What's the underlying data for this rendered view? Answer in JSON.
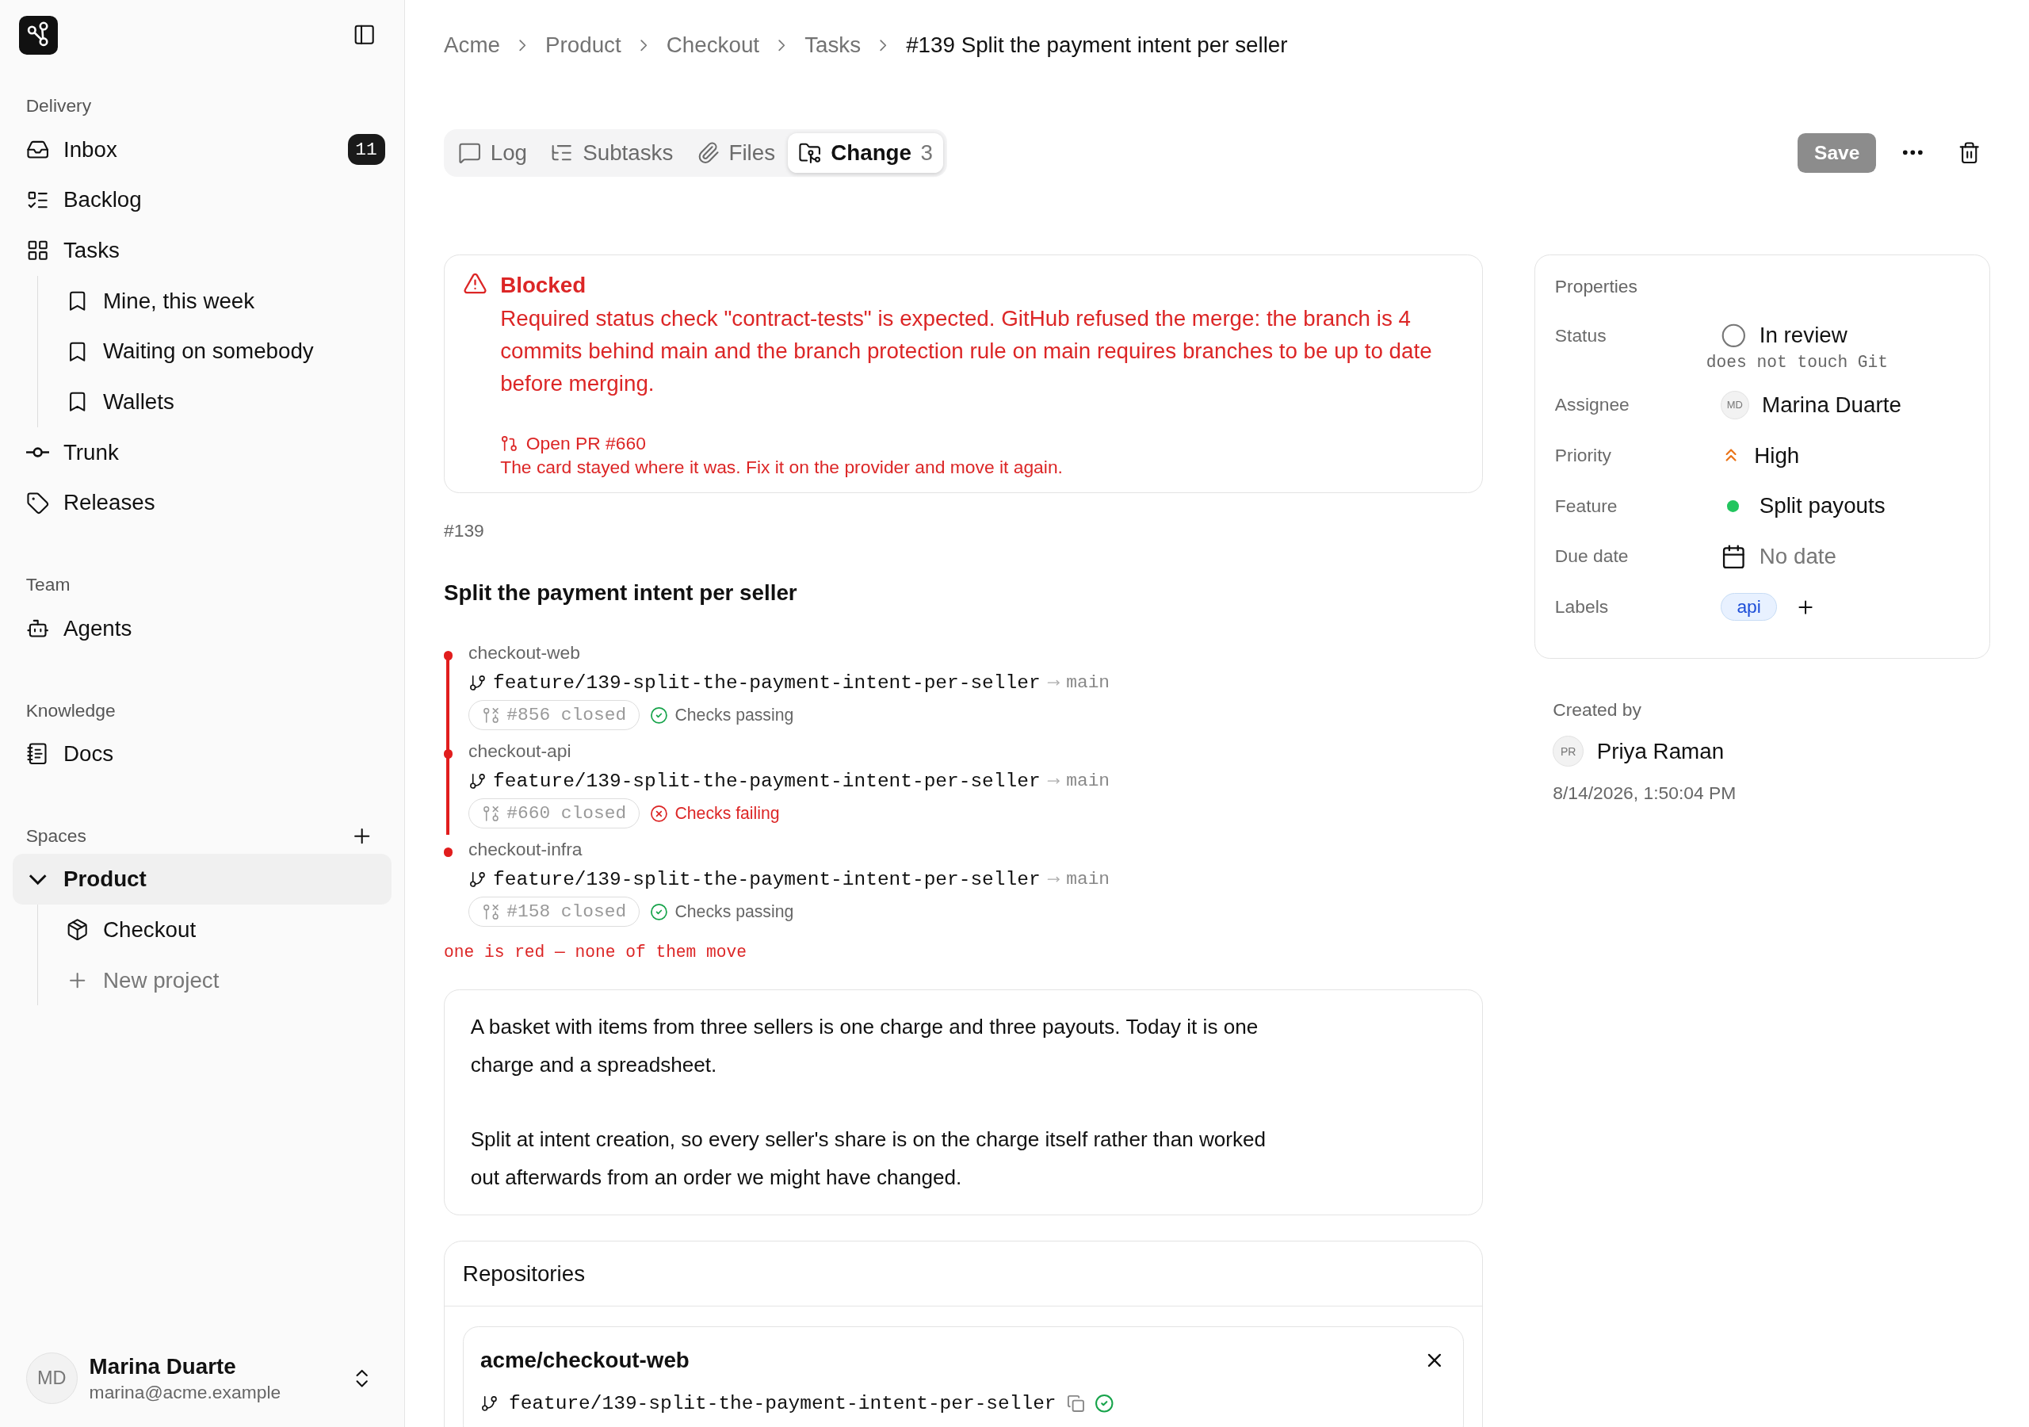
{
  "sidebar": {
    "sections": [
      {
        "label": "Delivery",
        "items": [
          {
            "label": "Inbox",
            "badge": "11",
            "selected": false
          },
          {
            "label": "Backlog",
            "selected": false
          },
          {
            "label": "Tasks",
            "selected": false,
            "children": [
              {
                "label": "Mine, this week",
                "selected": false
              },
              {
                "label": "Waiting on somebody",
                "selected": false
              },
              {
                "label": "Wallets",
                "selected": false
              }
            ]
          },
          {
            "label": "Trunk",
            "selected": false
          },
          {
            "label": "Releases",
            "selected": false
          }
        ]
      },
      {
        "label": "Team",
        "items": [
          {
            "label": "Agents",
            "selected": false
          }
        ]
      },
      {
        "label": "Knowledge",
        "items": [
          {
            "label": "Docs",
            "selected": false
          }
        ]
      },
      {
        "label": "Spaces",
        "can_add": true,
        "items": [
          {
            "label": "Product",
            "selected": true,
            "expanded": true,
            "children": [
              {
                "label": "Checkout",
                "kind": "project",
                "selected": false
              },
              {
                "label": "New project",
                "kind": "add",
                "selected": false
              }
            ]
          }
        ]
      }
    ],
    "user": {
      "initials": "MD",
      "name": "Marina Duarte",
      "email": "marina@acme.example"
    }
  },
  "breadcrumb": [
    "Acme",
    "Product",
    "Checkout",
    "Tasks",
    "#139 Split the payment intent per seller"
  ],
  "tabs": [
    {
      "label": "Log",
      "selected": false
    },
    {
      "label": "Subtasks",
      "selected": false
    },
    {
      "label": "Files",
      "selected": false
    },
    {
      "label": "Change",
      "count": "3",
      "selected": true
    }
  ],
  "save_button": {
    "label": "Save",
    "disabled": true
  },
  "alert": {
    "title": "Blocked",
    "message": "Required status check \"contract-tests\" is expected. GitHub refused the merge: the branch is 4 commits behind main and the branch protection rule on main requires branches to be up to date before merging.",
    "link": "Open PR #660",
    "note": "The card stayed where it was. Fix it on the provider and move it again."
  },
  "task": {
    "number": "#139",
    "title": "Split the payment intent per seller"
  },
  "changes": [
    {
      "repo": "checkout-web",
      "branch": "feature/139-split-the-payment-intent-per-seller",
      "target": "main",
      "pr": "#856 closed",
      "checks": "Checks passing",
      "kind": "passing"
    },
    {
      "repo": "checkout-api",
      "branch": "feature/139-split-the-payment-intent-per-seller",
      "target": "main",
      "pr": "#660 closed",
      "checks": "Checks failing",
      "kind": "failing"
    },
    {
      "repo": "checkout-infra",
      "branch": "feature/139-split-the-payment-intent-per-seller",
      "target": "main",
      "pr": "#158 closed",
      "checks": "Checks passing",
      "kind": "passing"
    }
  ],
  "changes_note": "one is red — none of them move",
  "description": [
    "A basket with items from three sellers is one charge and three payouts. Today it is one charge and a spreadsheet.",
    "Split at intent creation, so every seller's share is on the charge itself rather than worked out afterwards from an order we might have changed."
  ],
  "repositories": {
    "title": "Repositories",
    "items": [
      {
        "name": "acme/checkout-web",
        "branch": "feature/139-split-the-payment-intent-per-seller"
      }
    ]
  },
  "properties": {
    "title": "Properties",
    "rows": [
      {
        "kind": "status",
        "label": "Status",
        "value": "In review",
        "hint": "does not touch Git"
      },
      {
        "kind": "person",
        "label": "Assignee",
        "initials": "MD",
        "value": "Marina Duarte"
      },
      {
        "kind": "priority",
        "label": "Priority",
        "value": "High"
      },
      {
        "kind": "feature",
        "label": "Feature",
        "value": "Split payouts",
        "color": "#22c55e"
      },
      {
        "kind": "date",
        "label": "Due date",
        "value": "No date"
      },
      {
        "kind": "labels",
        "label": "Labels",
        "labels": [
          "api"
        ]
      }
    ]
  },
  "created": {
    "label": "Created by",
    "initials": "PR",
    "name": "Priya Raman",
    "date": "8/14/2026, 1:50:04 PM"
  }
}
